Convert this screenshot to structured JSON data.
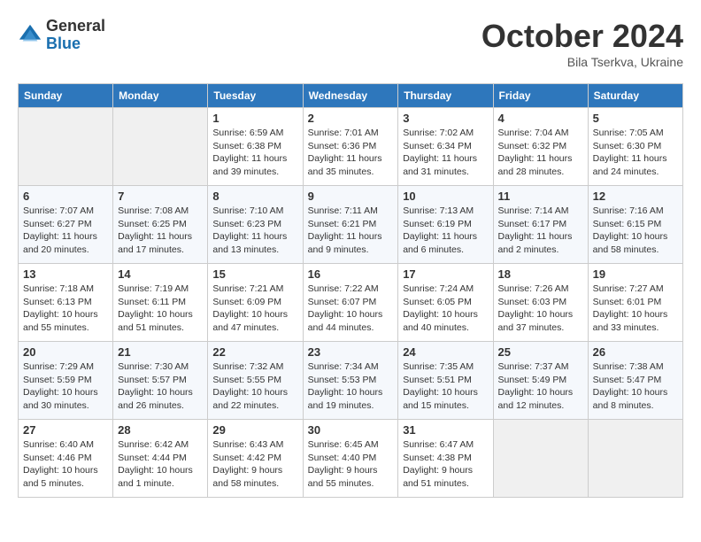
{
  "header": {
    "logo_general": "General",
    "logo_blue": "Blue",
    "month_title": "October 2024",
    "subtitle": "Bila Tserkva, Ukraine"
  },
  "columns": [
    "Sunday",
    "Monday",
    "Tuesday",
    "Wednesday",
    "Thursday",
    "Friday",
    "Saturday"
  ],
  "weeks": [
    [
      {
        "empty": true
      },
      {
        "empty": true
      },
      {
        "day": 1,
        "sunrise": "6:59 AM",
        "sunset": "6:38 PM",
        "daylight": "11 hours and 39 minutes."
      },
      {
        "day": 2,
        "sunrise": "7:01 AM",
        "sunset": "6:36 PM",
        "daylight": "11 hours and 35 minutes."
      },
      {
        "day": 3,
        "sunrise": "7:02 AM",
        "sunset": "6:34 PM",
        "daylight": "11 hours and 31 minutes."
      },
      {
        "day": 4,
        "sunrise": "7:04 AM",
        "sunset": "6:32 PM",
        "daylight": "11 hours and 28 minutes."
      },
      {
        "day": 5,
        "sunrise": "7:05 AM",
        "sunset": "6:30 PM",
        "daylight": "11 hours and 24 minutes."
      }
    ],
    [
      {
        "day": 6,
        "sunrise": "7:07 AM",
        "sunset": "6:27 PM",
        "daylight": "11 hours and 20 minutes."
      },
      {
        "day": 7,
        "sunrise": "7:08 AM",
        "sunset": "6:25 PM",
        "daylight": "11 hours and 17 minutes."
      },
      {
        "day": 8,
        "sunrise": "7:10 AM",
        "sunset": "6:23 PM",
        "daylight": "11 hours and 13 minutes."
      },
      {
        "day": 9,
        "sunrise": "7:11 AM",
        "sunset": "6:21 PM",
        "daylight": "11 hours and 9 minutes."
      },
      {
        "day": 10,
        "sunrise": "7:13 AM",
        "sunset": "6:19 PM",
        "daylight": "11 hours and 6 minutes."
      },
      {
        "day": 11,
        "sunrise": "7:14 AM",
        "sunset": "6:17 PM",
        "daylight": "11 hours and 2 minutes."
      },
      {
        "day": 12,
        "sunrise": "7:16 AM",
        "sunset": "6:15 PM",
        "daylight": "10 hours and 58 minutes."
      }
    ],
    [
      {
        "day": 13,
        "sunrise": "7:18 AM",
        "sunset": "6:13 PM",
        "daylight": "10 hours and 55 minutes."
      },
      {
        "day": 14,
        "sunrise": "7:19 AM",
        "sunset": "6:11 PM",
        "daylight": "10 hours and 51 minutes."
      },
      {
        "day": 15,
        "sunrise": "7:21 AM",
        "sunset": "6:09 PM",
        "daylight": "10 hours and 47 minutes."
      },
      {
        "day": 16,
        "sunrise": "7:22 AM",
        "sunset": "6:07 PM",
        "daylight": "10 hours and 44 minutes."
      },
      {
        "day": 17,
        "sunrise": "7:24 AM",
        "sunset": "6:05 PM",
        "daylight": "10 hours and 40 minutes."
      },
      {
        "day": 18,
        "sunrise": "7:26 AM",
        "sunset": "6:03 PM",
        "daylight": "10 hours and 37 minutes."
      },
      {
        "day": 19,
        "sunrise": "7:27 AM",
        "sunset": "6:01 PM",
        "daylight": "10 hours and 33 minutes."
      }
    ],
    [
      {
        "day": 20,
        "sunrise": "7:29 AM",
        "sunset": "5:59 PM",
        "daylight": "10 hours and 30 minutes."
      },
      {
        "day": 21,
        "sunrise": "7:30 AM",
        "sunset": "5:57 PM",
        "daylight": "10 hours and 26 minutes."
      },
      {
        "day": 22,
        "sunrise": "7:32 AM",
        "sunset": "5:55 PM",
        "daylight": "10 hours and 22 minutes."
      },
      {
        "day": 23,
        "sunrise": "7:34 AM",
        "sunset": "5:53 PM",
        "daylight": "10 hours and 19 minutes."
      },
      {
        "day": 24,
        "sunrise": "7:35 AM",
        "sunset": "5:51 PM",
        "daylight": "10 hours and 15 minutes."
      },
      {
        "day": 25,
        "sunrise": "7:37 AM",
        "sunset": "5:49 PM",
        "daylight": "10 hours and 12 minutes."
      },
      {
        "day": 26,
        "sunrise": "7:38 AM",
        "sunset": "5:47 PM",
        "daylight": "10 hours and 8 minutes."
      }
    ],
    [
      {
        "day": 27,
        "sunrise": "6:40 AM",
        "sunset": "4:46 PM",
        "daylight": "10 hours and 5 minutes."
      },
      {
        "day": 28,
        "sunrise": "6:42 AM",
        "sunset": "4:44 PM",
        "daylight": "10 hours and 1 minute."
      },
      {
        "day": 29,
        "sunrise": "6:43 AM",
        "sunset": "4:42 PM",
        "daylight": "9 hours and 58 minutes."
      },
      {
        "day": 30,
        "sunrise": "6:45 AM",
        "sunset": "4:40 PM",
        "daylight": "9 hours and 55 minutes."
      },
      {
        "day": 31,
        "sunrise": "6:47 AM",
        "sunset": "4:38 PM",
        "daylight": "9 hours and 51 minutes."
      },
      {
        "empty": true
      },
      {
        "empty": true
      }
    ]
  ]
}
